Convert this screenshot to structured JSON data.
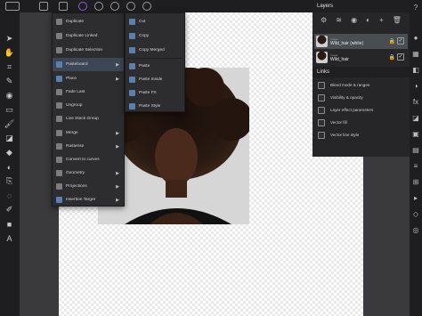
{
  "layers": {
    "title": "Layers",
    "items": [
      {
        "type": "Image",
        "name": "Wild_hair (white)",
        "selected": true
      },
      {
        "type": "Image",
        "name": "Wild_hair",
        "selected": false
      }
    ]
  },
  "links": {
    "title": "Links",
    "items": [
      "Blend mode & ranges",
      "Visibility & opacity",
      "Layer effect parameters",
      "Vector fill",
      "Vector line style"
    ]
  },
  "context_menu": {
    "items": [
      {
        "label": "Duplicate",
        "has_submenu": false
      },
      {
        "label": "Duplicate Linked",
        "has_submenu": false
      },
      {
        "label": "Duplicate Selection",
        "has_submenu": false
      },
      {
        "label": "Pasteboard",
        "has_submenu": true,
        "active": true
      },
      {
        "label": "Place",
        "has_submenu": true
      },
      {
        "label": "Fade Last",
        "has_submenu": false
      },
      {
        "label": "Ungroup",
        "has_submenu": false
      },
      {
        "label": "Live Stack Group",
        "has_submenu": false
      },
      {
        "label": "Merge",
        "has_submenu": true
      },
      {
        "label": "Rasterise",
        "has_submenu": true
      },
      {
        "label": "Convert to curves",
        "has_submenu": false
      },
      {
        "label": "Geometry",
        "has_submenu": true
      },
      {
        "label": "Projections",
        "has_submenu": true
      },
      {
        "label": "Insertion Target",
        "has_submenu": true
      }
    ]
  },
  "pasteboard_submenu": {
    "items": [
      "Cut",
      "Copy",
      "Copy Merged",
      "Paste",
      "Paste Inside",
      "Paste FX",
      "Paste Style"
    ]
  },
  "colors": {
    "accent": "#5b7fae",
    "panel": "#262628",
    "menu": "#2d2d30"
  }
}
